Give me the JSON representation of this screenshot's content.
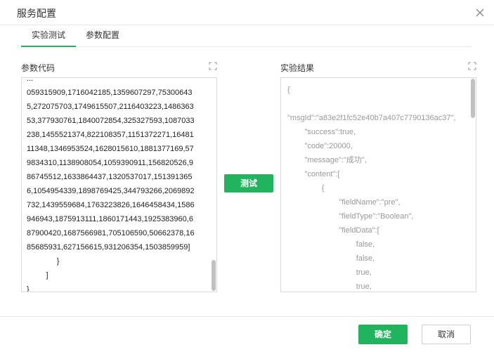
{
  "dialog": {
    "title": "服务配置",
    "close_icon": "close-icon"
  },
  "tabs": [
    {
      "label": "实验测试",
      "active": true
    },
    {
      "label": "参数配置",
      "active": false
    }
  ],
  "code_panel": {
    "label": "参数代码",
    "expand_icon": "expand-icon",
    "content": "...\n059315909,1716042185,1359607297,75300643\n5,272075703,1749615507,2116403223,1486363\n53,377930761,1840072854,325327593,1087033\n238,1455521374,822108357,1151372271,16481\n11348,1346953524,1628015610,1881377169,57\n9834310,1138908054,1059390911,156820526,9\n86745512,1633864437,1320537017,151391365\n6,1054954339,1898769425,344793266,2069892\n732,1439559684,1763223826,1646458434,1586\n946943,1875913111,1860171443,1925383960,6\n87900420,1687566981,705106590,50662378,16\n85685931,627156615,931206354,1503859959]\n              }\n         ]\n}"
  },
  "test_button": {
    "label": "测试"
  },
  "result_panel": {
    "label": "实验结果",
    "expand_icon": "expand-icon",
    "content": "{\n\n\"msgId\":\"a83e2f1fc52e40b7a407c7790136ac37\",\n        \"success\":true,\n        \"code\":20000,\n        \"message\":\"成功\",\n        \"content\":[\n                {\n                        \"fieldName\":\"pre\",\n                        \"fieldType\":\"Boolean\",\n                        \"fieldData\":[\n                                false,\n                                false,\n                                true,\n                                true,"
  },
  "footer": {
    "ok_label": "确定",
    "cancel_label": "取消"
  },
  "colors": {
    "accent": "#22b35e",
    "border": "#d9d9d9",
    "result_text": "#999999"
  }
}
